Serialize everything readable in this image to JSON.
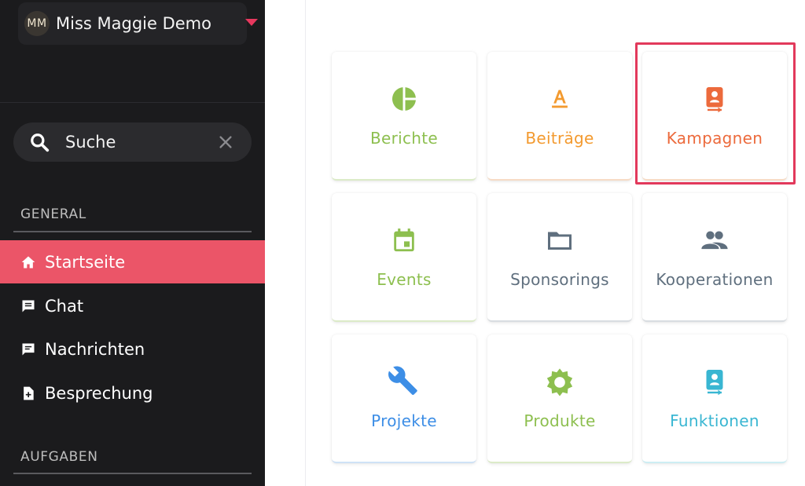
{
  "account": {
    "initials": "MM",
    "name": "Miss Maggie Demo"
  },
  "search": {
    "label": "Suche"
  },
  "sections": {
    "general": "GENERAL",
    "tasks": "AUFGABEN"
  },
  "nav": [
    {
      "label": "Startseite",
      "icon": "home-icon",
      "active": true
    },
    {
      "label": "Chat",
      "icon": "chat-icon"
    },
    {
      "label": "Nachrichten",
      "icon": "message-icon"
    },
    {
      "label": "Besprechung",
      "icon": "document-add-icon"
    }
  ],
  "tiles": [
    {
      "label": "Berichte",
      "icon": "pie-chart-icon",
      "color": "#8dbf4f"
    },
    {
      "label": "Beiträge",
      "icon": "text-format-icon",
      "color": "#f39a2f"
    },
    {
      "label": "Kampagnen",
      "icon": "campaign-icon",
      "color": "#ec6a3c"
    },
    {
      "label": "Events",
      "icon": "calendar-icon",
      "color": "#8dbf4f"
    },
    {
      "label": "Sponsorings",
      "icon": "folder-icon",
      "color": "#5f6f7e"
    },
    {
      "label": "Kooperationen",
      "icon": "people-icon",
      "color": "#5f6f7e"
    },
    {
      "label": "Projekte",
      "icon": "wrench-icon",
      "color": "#3d8ee6"
    },
    {
      "label": "Produkte",
      "icon": "gear-icon",
      "color": "#8dbf4f"
    },
    {
      "label": "Funktionen",
      "icon": "badge-icon",
      "color": "#39b6d2"
    }
  ],
  "colors": {
    "accent": "#eb5568",
    "sidebar": "#1b1b1d",
    "highlight": "#e2395b"
  }
}
